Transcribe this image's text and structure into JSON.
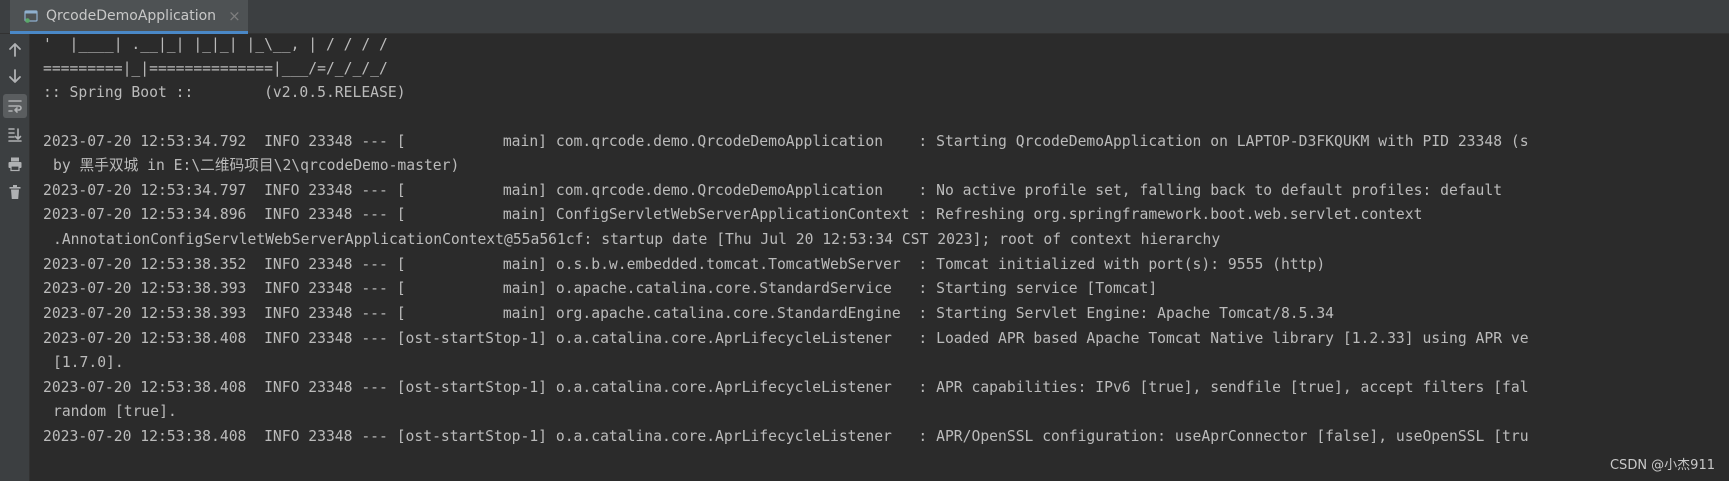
{
  "tab": {
    "label": "QrcodeDemoApplication",
    "close_glyph": "×",
    "icon": "spring-app-icon"
  },
  "gutter": {
    "buttons": [
      {
        "icon": "arrow-up-icon"
      },
      {
        "icon": "arrow-down-icon"
      },
      {
        "icon": "soft-wrap-icon",
        "active": true
      },
      {
        "icon": "scroll-to-end-icon"
      },
      {
        "icon": "print-icon"
      },
      {
        "icon": "trash-icon"
      }
    ]
  },
  "console": {
    "lines": [
      "'  |____| .__|_| |_|_| |_\\__, | / / / /",
      "=========|_|==============|___/=/_/_/_/",
      ":: Spring Boot ::        (v2.0.5.RELEASE)",
      "",
      "2023-07-20 12:53:34.792  INFO 23348 --- [           main] com.qrcode.demo.QrcodeDemoApplication    : Starting QrcodeDemoApplication on LAPTOP-D3FKQUKM with PID 23348 (s",
      "by 黑手双城 in E:\\二维码项目\\2\\qrcodeDemo-master)",
      "2023-07-20 12:53:34.797  INFO 23348 --- [           main] com.qrcode.demo.QrcodeDemoApplication    : No active profile set, falling back to default profiles: default",
      "2023-07-20 12:53:34.896  INFO 23348 --- [           main] ConfigServletWebServerApplicationContext : Refreshing org.springframework.boot.web.servlet.context",
      ".AnnotationConfigServletWebServerApplicationContext@55a561cf: startup date [Thu Jul 20 12:53:34 CST 2023]; root of context hierarchy",
      "2023-07-20 12:53:38.352  INFO 23348 --- [           main] o.s.b.w.embedded.tomcat.TomcatWebServer  : Tomcat initialized with port(s): 9555 (http)",
      "2023-07-20 12:53:38.393  INFO 23348 --- [           main] o.apache.catalina.core.StandardService   : Starting service [Tomcat]",
      "2023-07-20 12:53:38.393  INFO 23348 --- [           main] org.apache.catalina.core.StandardEngine  : Starting Servlet Engine: Apache Tomcat/8.5.34",
      "2023-07-20 12:53:38.408  INFO 23348 --- [ost-startStop-1] o.a.catalina.core.AprLifecycleListener   : Loaded APR based Apache Tomcat Native library [1.2.33] using APR ve",
      "[1.7.0].",
      "2023-07-20 12:53:38.408  INFO 23348 --- [ost-startStop-1] o.a.catalina.core.AprLifecycleListener   : APR capabilities: IPv6 [true], sendfile [true], accept filters [fal",
      "random [true].",
      "2023-07-20 12:53:38.408  INFO 23348 --- [ost-startStop-1] o.a.catalina.core.AprLifecycleListener   : APR/OpenSSL configuration: useAprConnector [false], useOpenSSL [tru"
    ]
  },
  "watermark": "CSDN @小杰911",
  "colors": {
    "background": "#2b2b2b",
    "text": "#bbbbbb",
    "accent": "#4a88c7"
  }
}
